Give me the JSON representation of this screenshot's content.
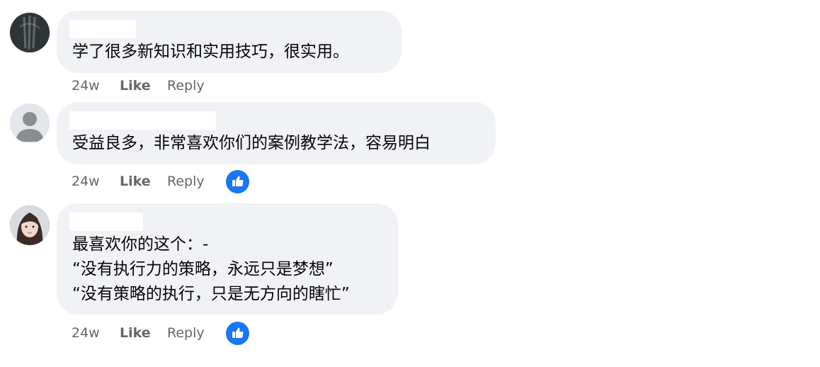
{
  "comments": [
    {
      "lines": [
        "学了很多新知识和实用技巧，很实用。"
      ],
      "time": "24w",
      "like": "Like",
      "reply": "Reply",
      "reaction": false
    },
    {
      "lines": [
        "受益良多，非常喜欢你们的案例教学法，容易明白"
      ],
      "time": "24w",
      "like": "Like",
      "reply": "Reply",
      "reaction": "like-icon"
    },
    {
      "lines": [
        "最喜欢你的这个：-",
        "“没有执行力的策略，永远只是梦想”",
        "“没有策略的执行，只是无方向的瞎忙”"
      ],
      "time": "24w",
      "like": "Like",
      "reply": "Reply",
      "reaction": "like-icon"
    }
  ],
  "colors": {
    "bubble": "#f0f2f5",
    "text": "#050505",
    "meta": "#65676b",
    "reaction": "#1877f2"
  }
}
